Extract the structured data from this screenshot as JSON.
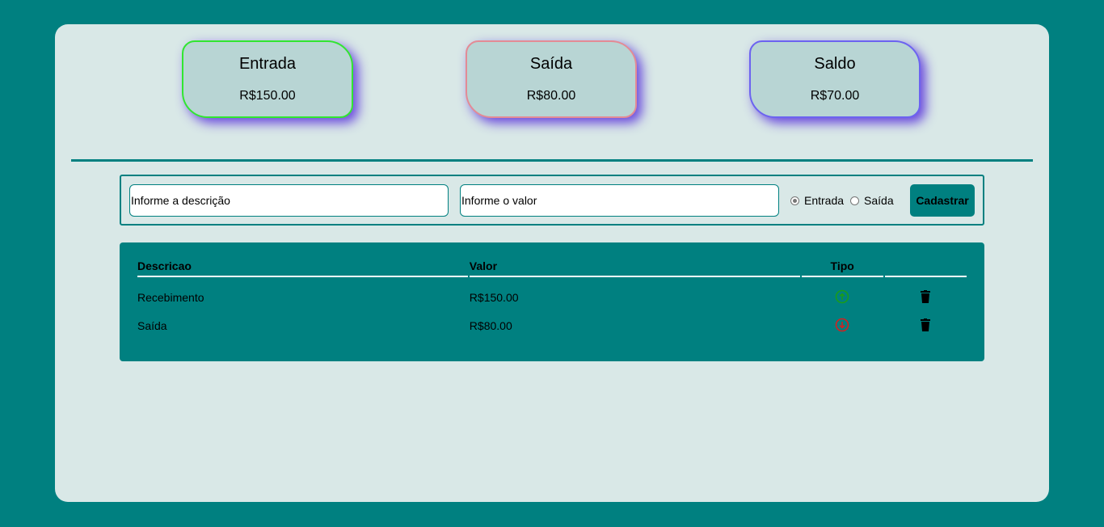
{
  "cards": {
    "entrada": {
      "title": "Entrada",
      "amount": "R$150.00"
    },
    "saida": {
      "title": "Saída",
      "amount": "R$80.00"
    },
    "saldo": {
      "title": "Saldo",
      "amount": "R$70.00"
    }
  },
  "form": {
    "description_placeholder": "Informe a descrição",
    "value_placeholder": "Informe o valor",
    "radio_entrada": "Entrada",
    "radio_saida": "Saída",
    "selected_type": "Entrada",
    "submit_label": "Cadastrar"
  },
  "table": {
    "headers": [
      "Descricao",
      "Valor",
      "Tipo",
      ""
    ],
    "rows": [
      {
        "descricao": "Recebimento",
        "valor": "R$150.00",
        "tipo_icon": "arrow-up-circle-icon",
        "delete_icon": "trash-icon"
      },
      {
        "descricao": "Saída",
        "valor": "R$80.00",
        "tipo_icon": "arrow-down-circle-icon",
        "delete_icon": "trash-icon"
      }
    ]
  },
  "colors": {
    "background": "#008080",
    "panel": "#d9e8e7",
    "card": "#b8d5d4",
    "entrada_border": "#31e631",
    "saida_border": "#e38b95",
    "saldo_border": "#6c63f0",
    "up_icon": "#1a9c1a",
    "down_icon": "#d32020"
  }
}
